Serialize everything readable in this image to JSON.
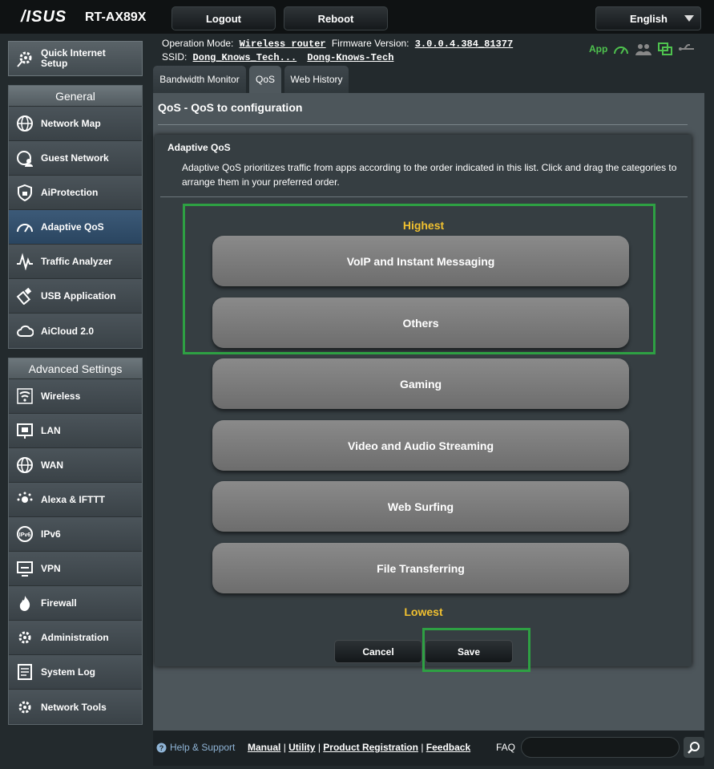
{
  "header": {
    "brand": "/ISUS",
    "model": "RT-AX89X",
    "logout_label": "Logout",
    "reboot_label": "Reboot",
    "language": "English"
  },
  "info": {
    "op_mode_label": "Operation Mode:",
    "op_mode_value": "Wireless router",
    "firmware_label": "Firmware Version:",
    "firmware_value": "3.0.0.4.384_81377",
    "ssid_label": "SSID:",
    "ssid_1": "Dong_Knows_Tech...",
    "ssid_2": "Dong-Knows-Tech",
    "app_label": "App"
  },
  "sidebar": {
    "quick_setup": "Quick Internet Setup",
    "general_header": "General",
    "general_items": [
      {
        "label": "Network Map",
        "icon": "globe-icon"
      },
      {
        "label": "Guest Network",
        "icon": "guest-network-icon"
      },
      {
        "label": "AiProtection",
        "icon": "shield-icon"
      },
      {
        "label": "Adaptive QoS",
        "icon": "gauge-icon"
      },
      {
        "label": "Traffic Analyzer",
        "icon": "pulse-icon"
      },
      {
        "label": "USB Application",
        "icon": "usb-icon"
      },
      {
        "label": "AiCloud 2.0",
        "icon": "cloud-icon"
      }
    ],
    "advanced_header": "Advanced Settings",
    "advanced_items": [
      {
        "label": "Wireless",
        "icon": "wifi-icon"
      },
      {
        "label": "LAN",
        "icon": "lan-icon"
      },
      {
        "label": "WAN",
        "icon": "wan-globe-icon"
      },
      {
        "label": "Alexa & IFTTT",
        "icon": "alexa-icon"
      },
      {
        "label": "IPv6",
        "icon": "ipv6-icon"
      },
      {
        "label": "VPN",
        "icon": "vpn-icon"
      },
      {
        "label": "Firewall",
        "icon": "fire-icon"
      },
      {
        "label": "Administration",
        "icon": "admin-gear-icon"
      },
      {
        "label": "System Log",
        "icon": "log-icon"
      },
      {
        "label": "Network Tools",
        "icon": "tools-icon"
      }
    ]
  },
  "tabs": [
    "Bandwidth Monitor",
    "QoS",
    "Web History"
  ],
  "main": {
    "title": "QoS - QoS to configuration",
    "card_title": "Adaptive QoS",
    "description": "Adaptive QoS prioritizes traffic from apps according to the order indicated in this list. Click and drag the categories to arrange them in your preferred order.",
    "highest_label": "Highest",
    "lowest_label": "Lowest",
    "categories": [
      "VoIP and Instant Messaging",
      "Others",
      "Gaming",
      "Video and Audio Streaming",
      "Web Surfing",
      "File Transferring"
    ],
    "cancel_label": "Cancel",
    "save_label": "Save"
  },
  "footer": {
    "help_label": "Help & Support",
    "manual": "Manual",
    "utility": "Utility",
    "registration": "Product Registration",
    "feedback": "Feedback",
    "faq_label": "FAQ"
  },
  "colors": {
    "priority_text": "#f0c030",
    "highlight_border": "#2ea043",
    "active_nav": "#2a4560"
  }
}
